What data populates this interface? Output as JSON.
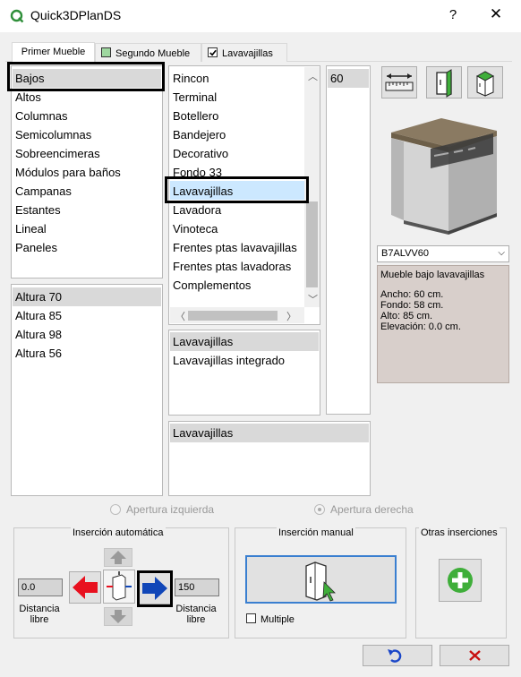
{
  "window": {
    "title": "Quick3DPlanDS",
    "help_label": "?",
    "close_label": "✕"
  },
  "tabs": [
    {
      "label": "Primer Mueble",
      "checked": null
    },
    {
      "label": "Segundo Mueble",
      "checked": false
    },
    {
      "label": "Lavavajillas",
      "checked": true
    }
  ],
  "categories": [
    "Bajos",
    "Altos",
    "Columnas",
    "Semicolumnas",
    "Sobreencimeras",
    "Módulos para baños",
    "Campanas",
    "Estantes",
    "Lineal",
    "Paneles"
  ],
  "subcategories": [
    "Rincon",
    "Terminal",
    "Botellero",
    "Bandejero",
    "Decorativo",
    "Fondo 33",
    "Lavavajillas",
    "Lavadora",
    "Vinoteca",
    "Frentes ptas lavavajillas",
    "Frentes ptas lavadoras",
    "Complementos"
  ],
  "widths": [
    "60"
  ],
  "heights": [
    "Altura 70",
    "Altura 85",
    "Altura 98",
    "Altura 56"
  ],
  "models": [
    "Lavavajillas",
    "Lavavajillas integrado"
  ],
  "variants": [
    "Lavavajillas"
  ],
  "product": {
    "code": "B7ALVV60",
    "description": "Mueble bajo lavavajillas",
    "ancho": "Ancho: 60 cm.",
    "fondo": "Fondo: 58 cm.",
    "alto": "Alto: 85 cm.",
    "elevacion": "Elevación: 0.0 cm."
  },
  "opening": {
    "left_label": "Apertura izquierda",
    "right_label": "Apertura derecha",
    "selected": "right"
  },
  "auto_insert": {
    "title": "Inserción automática",
    "left_value": "0.0",
    "right_value": "150",
    "left_label": "Distancia libre",
    "right_label": "Distancia libre"
  },
  "manual_insert": {
    "title": "Inserción manual",
    "multiple_label": "Multiple",
    "multiple_checked": false
  },
  "other_insert": {
    "title": "Otras inserciones"
  },
  "colors": {
    "selection": "#cce8ff",
    "accent_red": "#e8101e",
    "accent_blue": "#1046b8",
    "add_green": "#3fae3a",
    "undo_blue": "#1a46c8",
    "cancel_red": "#c81010"
  }
}
